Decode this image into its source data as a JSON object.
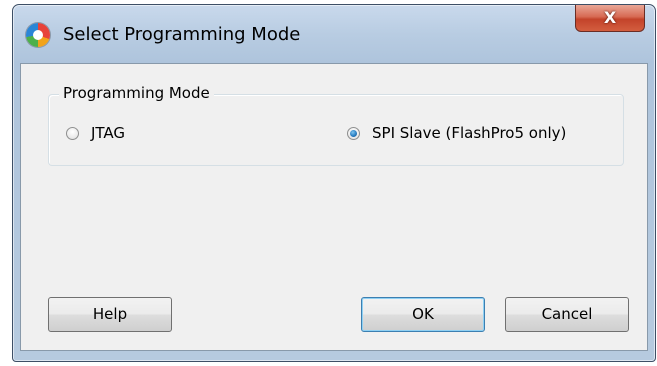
{
  "window": {
    "title": "Select Programming Mode",
    "close_label": "X"
  },
  "group": {
    "label": "Programming Mode",
    "options": [
      {
        "label": "JTAG",
        "checked": false
      },
      {
        "label": "SPI Slave (FlashPro5 only)",
        "checked": true
      }
    ]
  },
  "buttons": {
    "help": "Help",
    "ok": "OK",
    "cancel": "Cancel"
  },
  "colors": {
    "titlebar": "#b8cce2",
    "dialog_bg": "#f0f0f0",
    "close_button": "#c3432a",
    "radio_checked": "#2a7fc3",
    "default_button_border": "#3c7fb1"
  },
  "icons": {
    "app": "app-logo-icon",
    "close": "close-icon"
  }
}
